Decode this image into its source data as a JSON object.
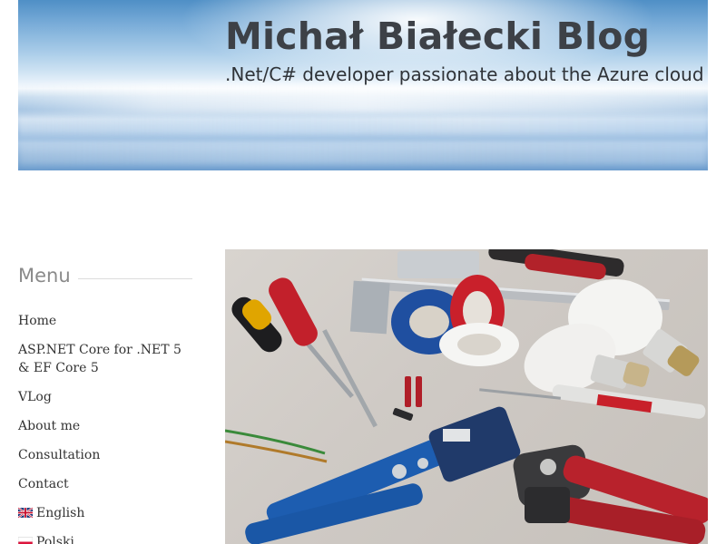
{
  "header": {
    "title": "Michał Białecki Blog",
    "tagline": ".Net/C# developer passionate about the Azure cloud"
  },
  "sidebar": {
    "menu_heading": "Menu",
    "items": [
      {
        "label": "Home"
      },
      {
        "label": "ASP.NET Core for .NET 5 & EF Core 5"
      },
      {
        "label": "VLog"
      },
      {
        "label": "About me"
      },
      {
        "label": "Consultation"
      },
      {
        "label": "Contact"
      },
      {
        "label": "English",
        "icon": "uk-flag-icon"
      },
      {
        "label": "Polski",
        "icon": "poland-flag-icon"
      }
    ]
  },
  "featured_image": {
    "subject": "electrician tools: screwdrivers, wire strippers, crimping pliers, tape, light bulbs, calipers"
  }
}
